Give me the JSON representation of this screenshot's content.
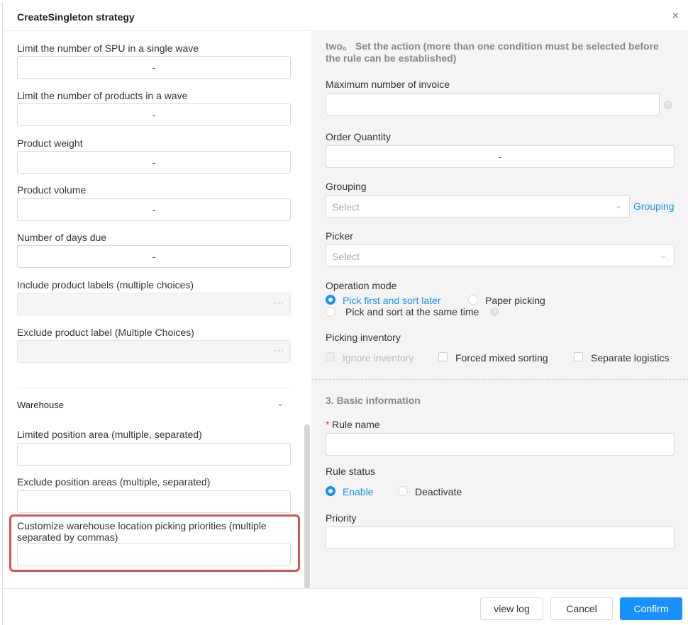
{
  "title": "CreateSingleton strategy",
  "close_glyph": "×",
  "left": {
    "fields": [
      {
        "label": "Limit the number of SPU in a single wave",
        "value": "-"
      },
      {
        "label": "Limit the number of products in a wave",
        "value": "-"
      },
      {
        "label": "Product weight",
        "value": "-"
      },
      {
        "label": "Product volume",
        "value": "-"
      },
      {
        "label": "Number of days due",
        "value": "-"
      }
    ],
    "include_labels": {
      "label": "Include product labels (multiple choices)",
      "icon": "ellipsis-icon"
    },
    "exclude_labels": {
      "label": "Exclude product label (Multiple Choices)",
      "icon": "ellipsis-icon"
    },
    "warehouse": {
      "title": "Warehouse",
      "icon": "chevron-down-icon"
    },
    "limited_area": {
      "label": "Limited position area (multiple, separated)",
      "value": ""
    },
    "exclude_area": {
      "label": "Exclude position areas (multiple, separated)",
      "value": ""
    },
    "custom_priority": {
      "label": "Customize warehouse location picking priorities (multiple separated by commas)",
      "value": ""
    }
  },
  "right": {
    "action_header": "two。 Set the action (more than one condition must be selected before the rule can be established)",
    "max_invoice": {
      "label": "Maximum number of invoice",
      "value": ""
    },
    "order_qty": {
      "label": "Order Quantity",
      "value": "-"
    },
    "grouping": {
      "label": "Grouping",
      "placeholder": "Select",
      "link": "Grouping"
    },
    "picker": {
      "label": "Picker",
      "placeholder": "Select"
    },
    "operation_mode": {
      "label": "Operation mode",
      "options": [
        "Pick first and sort later",
        "Paper picking",
        "Pick and sort at the same time"
      ],
      "selected": "Pick first and sort later"
    },
    "picking_inventory": {
      "label": "Picking inventory",
      "options": [
        "Ignore inventory",
        "Forced mixed sorting",
        "Separate logistics"
      ]
    },
    "basic_info": "3. Basic information",
    "rule_name": {
      "label": "Rule name",
      "required_mark": "*",
      "value": ""
    },
    "rule_status": {
      "label": "Rule status",
      "options": [
        "Enable",
        "Deactivate"
      ],
      "selected": "Enable"
    },
    "priority": {
      "label": "Priority",
      "value": ""
    }
  },
  "footer": {
    "view_log": "view log",
    "cancel": "Cancel",
    "confirm": "Confirm"
  },
  "colors": {
    "accent": "#1890ff",
    "highlight": "#d9534f"
  }
}
